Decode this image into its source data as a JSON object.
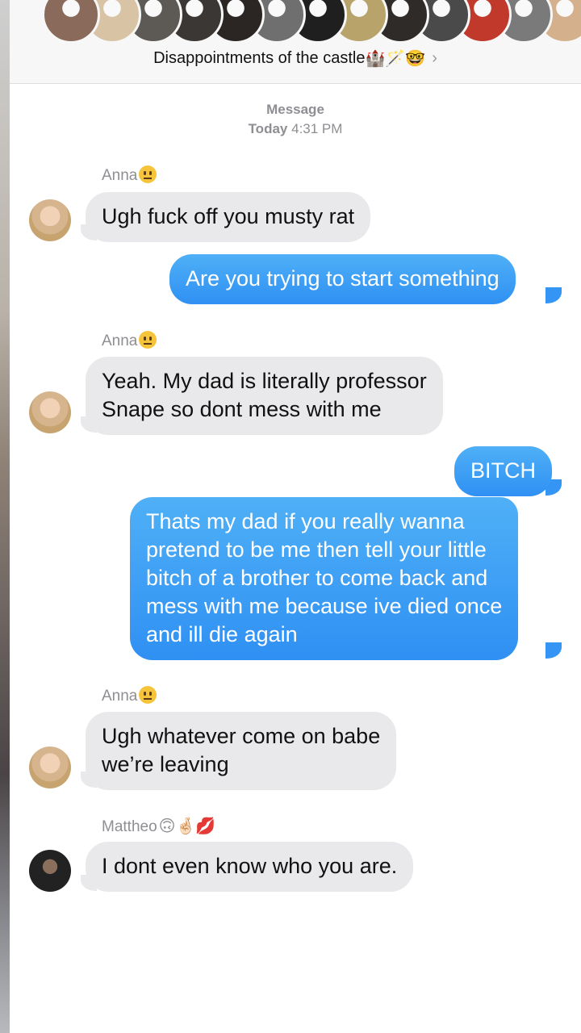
{
  "header": {
    "title": "Disappointments of the castle",
    "title_emojis": "🏰🪄🤓",
    "chevron": "›",
    "avatar_colors": [
      "#8a6a5a",
      "#d8c3a5",
      "#5d5a55",
      "#3b3735",
      "#2b2623",
      "#6f6f6f",
      "#1f1f1f",
      "#b8a36a",
      "#2e2b28",
      "#4a4a4a",
      "#c0392b",
      "#7a7a7a",
      "#d5b08c"
    ]
  },
  "timestamp": {
    "service": "Message",
    "day": "Today",
    "time": "4:31 PM"
  },
  "messages": [
    {
      "sender": "Anna",
      "sender_emoji": "😐",
      "text": "Ugh fuck off you musty rat",
      "direction": "incoming"
    },
    {
      "text": "Are you trying to start something",
      "direction": "outgoing"
    },
    {
      "sender": "Anna",
      "sender_emoji": "😐",
      "lines": [
        "Yeah. My dad is literally professor",
        "Snape so dont mess with me"
      ],
      "direction": "incoming"
    },
    {
      "text": "BITCH",
      "direction": "outgoing"
    },
    {
      "lines": [
        "Thats my dad if you really wanna",
        "pretend to be me then tell your little",
        "bitch of a brother to come back and",
        "mess with me because ive died once",
        "and ill die again"
      ],
      "direction": "outgoing"
    },
    {
      "sender": "Anna",
      "sender_emoji": "😐",
      "lines": [
        "Ugh whatever come on babe",
        "we’re leaving"
      ],
      "direction": "incoming"
    },
    {
      "sender": "Mattheo",
      "sender_emoji": "🙃🤞🏻💋",
      "text": "I dont even know who you are.",
      "direction": "incoming"
    }
  ],
  "colors": {
    "outgoing": "#3595f4",
    "incoming": "#e9e9eb",
    "meta_text": "#8e8e93"
  }
}
